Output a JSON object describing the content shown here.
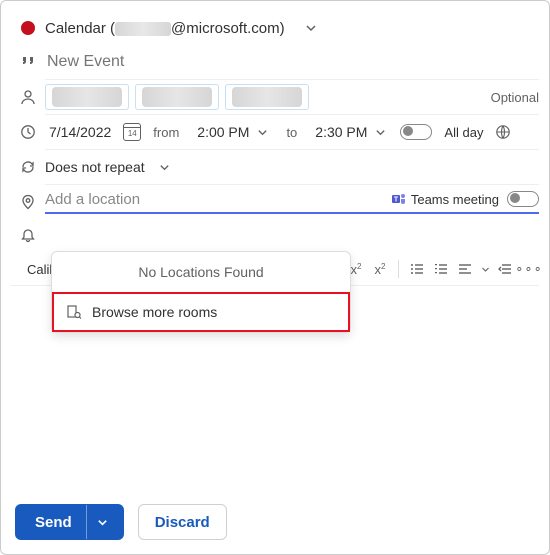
{
  "header": {
    "title": "Calendar (",
    "domain": "@microsoft.com)"
  },
  "event": {
    "title_placeholder": "New Event",
    "optional_label": "Optional",
    "date": "7/14/2022",
    "from_label": "from",
    "start_time": "2:00 PM",
    "to_label": "to",
    "end_time": "2:30 PM",
    "allday_label": "All day",
    "repeat_label": "Does not repeat",
    "location_placeholder": "Add a location",
    "teams_label": "Teams meeting"
  },
  "location_dropdown": {
    "no_results": "No Locations Found",
    "browse_label": "Browse more rooms"
  },
  "toolbar": {
    "font": "Calibri"
  },
  "footer": {
    "send": "Send",
    "discard": "Discard"
  }
}
